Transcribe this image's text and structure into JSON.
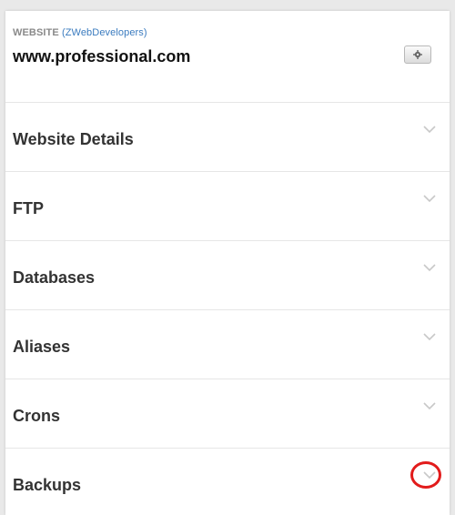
{
  "header": {
    "eyebrow_label": "WEBSITE",
    "owner_open": " (",
    "owner_name": "ZWebDevelopers",
    "owner_close": ")",
    "site_title": "www.professional.com",
    "settings_icon": "gear-icon"
  },
  "accordion": {
    "items": [
      {
        "label": "Website Details",
        "icon": "chevron-down-icon"
      },
      {
        "label": "FTP",
        "icon": "chevron-down-icon"
      },
      {
        "label": "Databases",
        "icon": "chevron-down-icon"
      },
      {
        "label": "Aliases",
        "icon": "chevron-down-icon"
      },
      {
        "label": "Crons",
        "icon": "chevron-down-icon"
      },
      {
        "label": "Backups",
        "icon": "chevron-down-icon"
      }
    ]
  },
  "annotation": {
    "highlight_color": "#e21b1b",
    "highlighted_item": "Backups"
  },
  "colors": {
    "background": "#e9e9e9",
    "panel": "#ffffff",
    "link": "#3a7bbf",
    "chevron": "#c8c8c8"
  }
}
